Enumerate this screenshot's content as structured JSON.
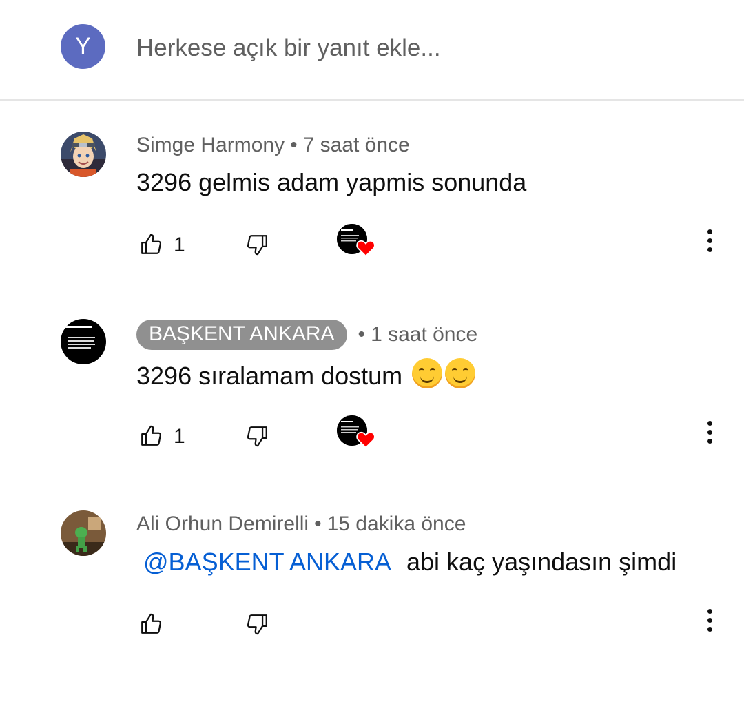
{
  "reply_box": {
    "avatar_letter": "Y",
    "placeholder": "Herkese açık bir yanıt ekle..."
  },
  "comments": [
    {
      "author": "Simge Harmony",
      "time": "7 saat önce",
      "text": "3296 gelmis adam yapmis sonunda",
      "likes": "1",
      "hearted": true
    },
    {
      "author": "BAŞKENT ANKARA",
      "time": "1 saat önce",
      "text": "3296 sıralamam dostum",
      "emoji": "😊😊",
      "likes": "1",
      "hearted": true,
      "author_highlighted": true
    },
    {
      "author": "Ali Orhun Demirelli",
      "time": "15 dakika önce",
      "mention": "@BAŞKENT ANKARA",
      "text": "abi kaç yaşındasın şimdi",
      "likes": "",
      "hearted": false
    }
  ],
  "separator": "•",
  "colors": {
    "reply_avatar_bg": "#5c6bc0",
    "mention": "#065fd4",
    "author_chip_bg": "#909090",
    "heart": "#ff0000"
  }
}
